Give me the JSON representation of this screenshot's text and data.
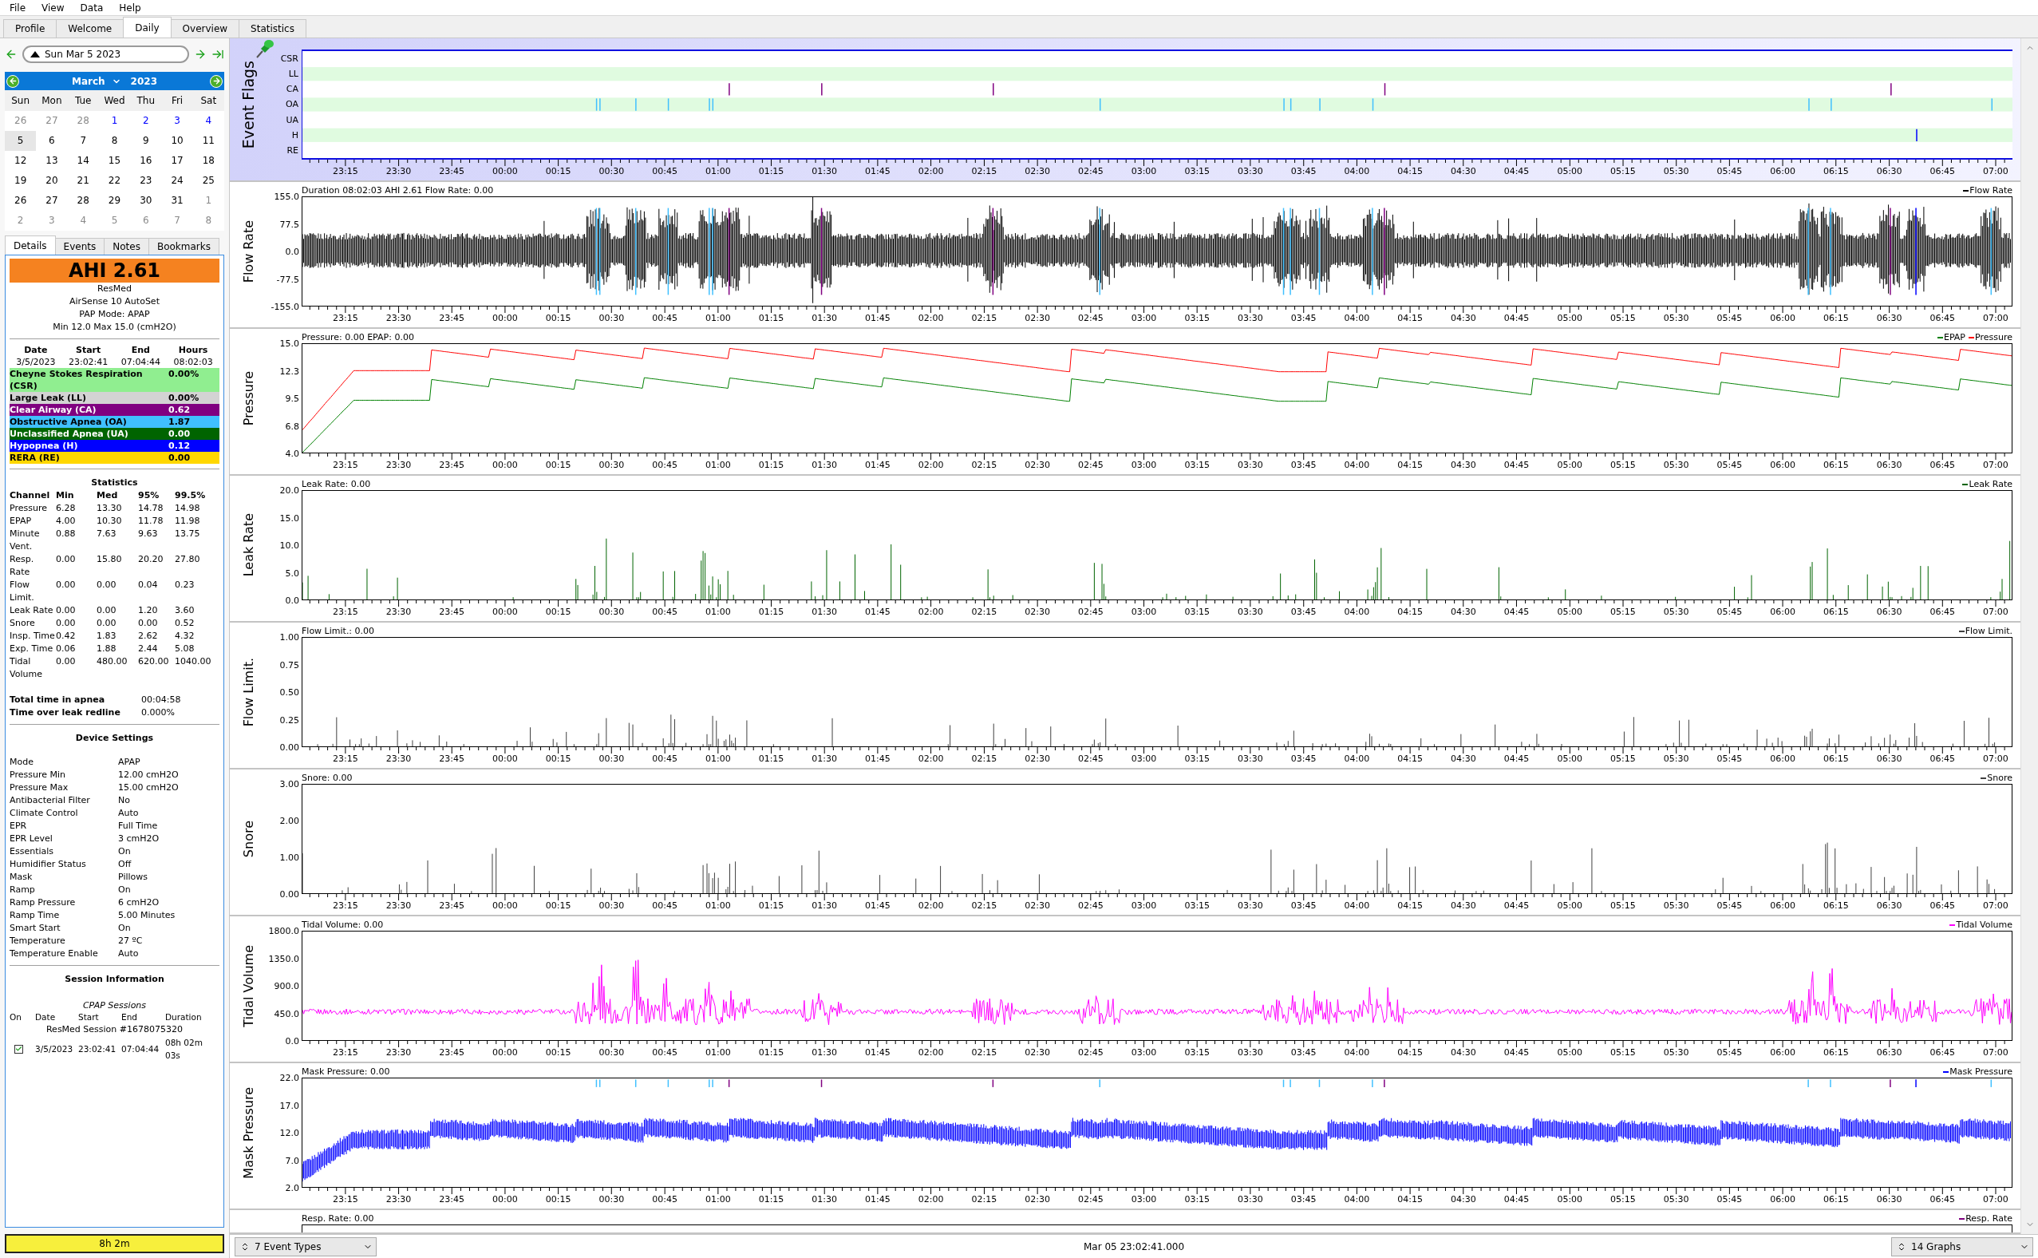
{
  "menu": [
    "File",
    "View",
    "Data",
    "Help"
  ],
  "tabs": [
    {
      "label": "Profile",
      "selected": false
    },
    {
      "label": "Welcome",
      "selected": false
    },
    {
      "label": "Daily",
      "selected": true
    },
    {
      "label": "Overview",
      "selected": false
    },
    {
      "label": "Statistics",
      "selected": false
    }
  ],
  "date_nav": {
    "date": "Sun Mar 5 2023"
  },
  "calendar": {
    "month": "March",
    "year": "2023",
    "weekdays": [
      "Sun",
      "Mon",
      "Tue",
      "Wed",
      "Thu",
      "Fri",
      "Sat"
    ],
    "weeks": [
      [
        {
          "day": "26",
          "kind": "outside",
          "selected": false
        },
        {
          "day": "27",
          "kind": "outside",
          "selected": false
        },
        {
          "day": "28",
          "kind": "outside",
          "selected": false
        },
        {
          "day": "1",
          "kind": "highlight",
          "selected": false
        },
        {
          "day": "2",
          "kind": "highlight",
          "selected": false
        },
        {
          "day": "3",
          "kind": "highlight",
          "selected": false
        },
        {
          "day": "4",
          "kind": "highlight",
          "selected": false
        }
      ],
      [
        {
          "day": "5",
          "kind": "normal",
          "selected": true
        },
        {
          "day": "6",
          "kind": "normal",
          "selected": false
        },
        {
          "day": "7",
          "kind": "normal",
          "selected": false
        },
        {
          "day": "8",
          "kind": "normal",
          "selected": false
        },
        {
          "day": "9",
          "kind": "normal",
          "selected": false
        },
        {
          "day": "10",
          "kind": "normal",
          "selected": false
        },
        {
          "day": "11",
          "kind": "normal",
          "selected": false
        }
      ],
      [
        {
          "day": "12",
          "kind": "normal",
          "selected": false
        },
        {
          "day": "13",
          "kind": "normal",
          "selected": false
        },
        {
          "day": "14",
          "kind": "normal",
          "selected": false
        },
        {
          "day": "15",
          "kind": "normal",
          "selected": false
        },
        {
          "day": "16",
          "kind": "normal",
          "selected": false
        },
        {
          "day": "17",
          "kind": "normal",
          "selected": false
        },
        {
          "day": "18",
          "kind": "normal",
          "selected": false
        }
      ],
      [
        {
          "day": "19",
          "kind": "normal",
          "selected": false
        },
        {
          "day": "20",
          "kind": "normal",
          "selected": false
        },
        {
          "day": "21",
          "kind": "normal",
          "selected": false
        },
        {
          "day": "22",
          "kind": "normal",
          "selected": false
        },
        {
          "day": "23",
          "kind": "normal",
          "selected": false
        },
        {
          "day": "24",
          "kind": "normal",
          "selected": false
        },
        {
          "day": "25",
          "kind": "normal",
          "selected": false
        }
      ],
      [
        {
          "day": "26",
          "kind": "normal",
          "selected": false
        },
        {
          "day": "27",
          "kind": "normal",
          "selected": false
        },
        {
          "day": "28",
          "kind": "normal",
          "selected": false
        },
        {
          "day": "29",
          "kind": "normal",
          "selected": false
        },
        {
          "day": "30",
          "kind": "normal",
          "selected": false
        },
        {
          "day": "31",
          "kind": "normal",
          "selected": false
        },
        {
          "day": "1",
          "kind": "outside",
          "selected": false
        }
      ],
      [
        {
          "day": "2",
          "kind": "outside",
          "selected": false
        },
        {
          "day": "3",
          "kind": "outside",
          "selected": false
        },
        {
          "day": "4",
          "kind": "outside",
          "selected": false
        },
        {
          "day": "5",
          "kind": "outside",
          "selected": false
        },
        {
          "day": "6",
          "kind": "outside",
          "selected": false
        },
        {
          "day": "7",
          "kind": "outside",
          "selected": false
        },
        {
          "day": "8",
          "kind": "outside",
          "selected": false
        }
      ]
    ]
  },
  "detail_tabs": [
    {
      "label": "Details",
      "selected": true
    },
    {
      "label": "Events",
      "selected": false
    },
    {
      "label": "Notes",
      "selected": false
    },
    {
      "label": "Bookmarks",
      "selected": false
    }
  ],
  "ahi": "AHI 2.61",
  "device_info": [
    "ResMed",
    "AirSense 10 AutoSet",
    "PAP Mode: APAP",
    "Min 12.0 Max 15.0 (cmH2O)"
  ],
  "session_summary": {
    "columns": [
      "Date",
      "Start",
      "End",
      "Hours"
    ],
    "values": [
      "3/5/2023",
      "23:02:41",
      "07:04:44",
      "08:02:03"
    ]
  },
  "indices": [
    {
      "label": "Cheyne Stokes Respiration (CSR)",
      "value": "0.00%",
      "color": "#90ee90"
    },
    {
      "label": "Large Leak (LL)",
      "value": "0.00%",
      "color": "#d3d3d3"
    },
    {
      "label": "Clear Airway (CA)",
      "value": "0.62",
      "color": "#800080"
    },
    {
      "label": "Obstructive Apnea (OA)",
      "value": "1.87",
      "color": "#40c0ff"
    },
    {
      "label": "Unclassified Apnea (UA)",
      "value": "0.00",
      "color": "#006400"
    },
    {
      "label": "Hypopnea (H)",
      "value": "0.12",
      "color": "#0000ff"
    },
    {
      "label": "RERA (RE)",
      "value": "0.00",
      "color": "#ffd700"
    }
  ],
  "statistics": {
    "title": "Statistics",
    "columns": [
      "Channel",
      "Min",
      "Med",
      "95%",
      "99.5%"
    ],
    "rows": [
      [
        "Pressure",
        "6.28",
        "13.30",
        "14.78",
        "14.98"
      ],
      [
        "EPAP",
        "4.00",
        "10.30",
        "11.78",
        "11.98"
      ],
      [
        "Minute Vent.",
        "0.88",
        "7.63",
        "9.63",
        "13.75"
      ],
      [
        "Resp. Rate",
        "0.00",
        "15.80",
        "20.20",
        "27.80"
      ],
      [
        "Flow Limit.",
        "0.00",
        "0.00",
        "0.04",
        "0.23"
      ],
      [
        "Leak Rate",
        "0.00",
        "0.00",
        "1.20",
        "3.60"
      ],
      [
        "Snore",
        "0.00",
        "0.00",
        "0.00",
        "0.52"
      ],
      [
        "Insp. Time",
        "0.42",
        "1.83",
        "2.62",
        "4.32"
      ],
      [
        "Exp. Time",
        "0.06",
        "1.88",
        "2.44",
        "5.08"
      ],
      [
        "Tidal Volume",
        "0.00",
        "480.00",
        "620.00",
        "1040.00"
      ]
    ]
  },
  "totals": [
    {
      "label": "Total time in apnea",
      "value": "00:04:58"
    },
    {
      "label": "Time over leak redline",
      "value": "0.000%"
    }
  ],
  "device_settings": {
    "title": "Device Settings",
    "rows": [
      [
        "Mode",
        "APAP"
      ],
      [
        "Pressure Min",
        "12.00 cmH2O"
      ],
      [
        "Pressure Max",
        "15.00 cmH2O"
      ],
      [
        "Antibacterial Filter",
        "No"
      ],
      [
        "Climate Control",
        "Auto"
      ],
      [
        "EPR",
        "Full Time"
      ],
      [
        "EPR Level",
        "3 cmH2O"
      ],
      [
        "Essentials",
        "On"
      ],
      [
        "Humidifier Status",
        "Off"
      ],
      [
        "Mask",
        "Pillows"
      ],
      [
        "Ramp",
        "On"
      ],
      [
        "Ramp Pressure",
        "6 cmH2O"
      ],
      [
        "Ramp Time",
        "5.00 Minutes"
      ],
      [
        "Smart Start",
        "On"
      ],
      [
        "Temperature",
        "27 ºC"
      ],
      [
        "Temperature Enable",
        "Auto"
      ]
    ]
  },
  "session_info": {
    "title": "Session Information",
    "subtitle": "CPAP Sessions",
    "columns": [
      "On",
      "Date",
      "Start",
      "End",
      "Duration"
    ],
    "group": "ResMed Session #1678075320",
    "sessions": [
      {
        "checked": true,
        "date": "3/5/2023",
        "start": "23:02:41",
        "end": "07:04:44",
        "duration": "08h 02m 03s"
      }
    ]
  },
  "usage_bar": "8h 2m",
  "graphs": [
    {
      "kind": "flags",
      "title": "Event Flags",
      "rows": [
        "CSR",
        "LL",
        "CA",
        "OA",
        "UA",
        "H",
        "RE"
      ],
      "x_labels": [
        "23:15",
        "23:30",
        "23:45",
        "00:00",
        "00:15",
        "00:30",
        "00:45",
        "01:00",
        "01:15",
        "01:30",
        "01:45",
        "02:00",
        "02:15",
        "02:30",
        "02:45",
        "03:00",
        "03:15",
        "03:30",
        "03:45",
        "04:00",
        "04:15",
        "04:30",
        "04:45",
        "05:00",
        "05:15",
        "05:30",
        "05:45",
        "06:00",
        "06:15",
        "06:30",
        "06:45",
        "07:00"
      ]
    },
    {
      "kind": "flow",
      "title": "Flow Rate",
      "header": "Duration 08:02:03 AHI 2.61 Flow Rate: 0.00",
      "legend": [
        {
          "label": "Flow Rate",
          "color": "#000000"
        }
      ],
      "y_labels": [
        "155.0",
        "77.5",
        "0.0",
        "-77.5",
        "-155.0"
      ],
      "x_labels": [
        "23:15",
        "23:30",
        "23:45",
        "00:00",
        "00:15",
        "00:30",
        "00:45",
        "01:00",
        "01:15",
        "01:30",
        "01:45",
        "02:00",
        "02:15",
        "02:30",
        "02:45",
        "03:00",
        "03:15",
        "03:30",
        "03:45",
        "04:00",
        "04:15",
        "04:30",
        "04:45",
        "05:00",
        "05:15",
        "05:30",
        "05:45",
        "06:00",
        "06:15",
        "06:30",
        "06:45",
        "07:00"
      ]
    },
    {
      "kind": "pressure",
      "title": "Pressure",
      "header": "Pressure: 0.00 EPAP: 0.00",
      "legend": [
        {
          "label": "EPAP",
          "color": "#008000"
        },
        {
          "label": "Pressure",
          "color": "#ff0000"
        }
      ],
      "y_labels": [
        "15.0",
        "12.3",
        "9.5",
        "6.8",
        "4.0"
      ],
      "x_labels": [
        "23:15",
        "23:30",
        "23:45",
        "00:00",
        "00:15",
        "00:30",
        "00:45",
        "01:00",
        "01:15",
        "01:30",
        "01:45",
        "02:00",
        "02:15",
        "02:30",
        "02:45",
        "03:00",
        "03:15",
        "03:30",
        "03:45",
        "04:00",
        "04:15",
        "04:30",
        "04:45",
        "05:00",
        "05:15",
        "05:30",
        "05:45",
        "06:00",
        "06:15",
        "06:30",
        "06:45",
        "07:00"
      ]
    },
    {
      "kind": "leak",
      "title": "Leak Rate",
      "header": "Leak Rate: 0.00",
      "legend": [
        {
          "label": "Leak Rate",
          "color": "#006400"
        }
      ],
      "y_labels": [
        "20.0",
        "15.0",
        "10.0",
        "5.0",
        "0.0"
      ],
      "x_labels": [
        "23:15",
        "23:30",
        "23:45",
        "00:00",
        "00:15",
        "00:30",
        "00:45",
        "01:00",
        "01:15",
        "01:30",
        "01:45",
        "02:00",
        "02:15",
        "02:30",
        "02:45",
        "03:00",
        "03:15",
        "03:30",
        "03:45",
        "04:00",
        "04:15",
        "04:30",
        "04:45",
        "05:00",
        "05:15",
        "05:30",
        "05:45",
        "06:00",
        "06:15",
        "06:30",
        "06:45",
        "07:00"
      ]
    },
    {
      "kind": "limit",
      "title": "Flow Limit.",
      "header": "Flow Limit.: 0.00",
      "legend": [
        {
          "label": "Flow Limit.",
          "color": "#404040"
        }
      ],
      "y_labels": [
        "1.00",
        "0.75",
        "0.50",
        "0.25",
        "0.00"
      ],
      "x_labels": [
        "23:15",
        "23:30",
        "23:45",
        "00:00",
        "00:15",
        "00:30",
        "00:45",
        "01:00",
        "01:15",
        "01:30",
        "01:45",
        "02:00",
        "02:15",
        "02:30",
        "02:45",
        "03:00",
        "03:15",
        "03:30",
        "03:45",
        "04:00",
        "04:15",
        "04:30",
        "04:45",
        "05:00",
        "05:15",
        "05:30",
        "05:45",
        "06:00",
        "06:15",
        "06:30",
        "06:45",
        "07:00"
      ]
    },
    {
      "kind": "snore",
      "title": "Snore",
      "header": "Snore: 0.00",
      "legend": [
        {
          "label": "Snore",
          "color": "#404040"
        }
      ],
      "y_labels": [
        "3.00",
        "2.00",
        "1.00",
        "0.00"
      ],
      "x_labels": [
        "23:15",
        "23:30",
        "23:45",
        "00:00",
        "00:15",
        "00:30",
        "00:45",
        "01:00",
        "01:15",
        "01:30",
        "01:45",
        "02:00",
        "02:15",
        "02:30",
        "02:45",
        "03:00",
        "03:15",
        "03:30",
        "03:45",
        "04:00",
        "04:15",
        "04:30",
        "04:45",
        "05:00",
        "05:15",
        "05:30",
        "05:45",
        "06:00",
        "06:15",
        "06:30",
        "06:45",
        "07:00"
      ]
    },
    {
      "kind": "tidal",
      "title": "Tidal Volume",
      "header": "Tidal Volume: 0.00",
      "legend": [
        {
          "label": "Tidal Volume",
          "color": "#ff00ff"
        }
      ],
      "y_labels": [
        "1800.0",
        "1350.0",
        "900.0",
        "450.0",
        "0.0"
      ],
      "x_labels": [
        "23:15",
        "23:30",
        "23:45",
        "00:00",
        "00:15",
        "00:30",
        "00:45",
        "01:00",
        "01:15",
        "01:30",
        "01:45",
        "02:00",
        "02:15",
        "02:30",
        "02:45",
        "03:00",
        "03:15",
        "03:30",
        "03:45",
        "04:00",
        "04:15",
        "04:30",
        "04:45",
        "05:00",
        "05:15",
        "05:30",
        "05:45",
        "06:00",
        "06:15",
        "06:30",
        "06:45",
        "07:00"
      ]
    },
    {
      "kind": "mask",
      "title": "Mask Pressure",
      "header": "Mask Pressure: 0.00",
      "legend": [
        {
          "label": "Mask Pressure",
          "color": "#0000ff"
        }
      ],
      "y_labels": [
        "22.0",
        "17.0",
        "12.0",
        "7.0",
        "2.0"
      ],
      "x_labels": [
        "23:15",
        "23:30",
        "23:45",
        "00:00",
        "00:15",
        "00:30",
        "00:45",
        "01:00",
        "01:15",
        "01:30",
        "01:45",
        "02:00",
        "02:15",
        "02:30",
        "02:45",
        "03:00",
        "03:15",
        "03:30",
        "03:45",
        "04:00",
        "04:15",
        "04:30",
        "04:45",
        "05:00",
        "05:15",
        "05:30",
        "05:45",
        "06:00",
        "06:15",
        "06:30",
        "06:45",
        "07:00"
      ]
    },
    {
      "kind": "empty",
      "header": "Resp. Rate: 0.00",
      "legend": [
        {
          "label": "Resp. Rate",
          "color": "#800080"
        }
      ]
    }
  ],
  "bottom_bar": {
    "event_types": "7 Event Types",
    "cursor_time": "Mar 05 23:02:41.000",
    "graphs_count": "14 Graphs"
  }
}
